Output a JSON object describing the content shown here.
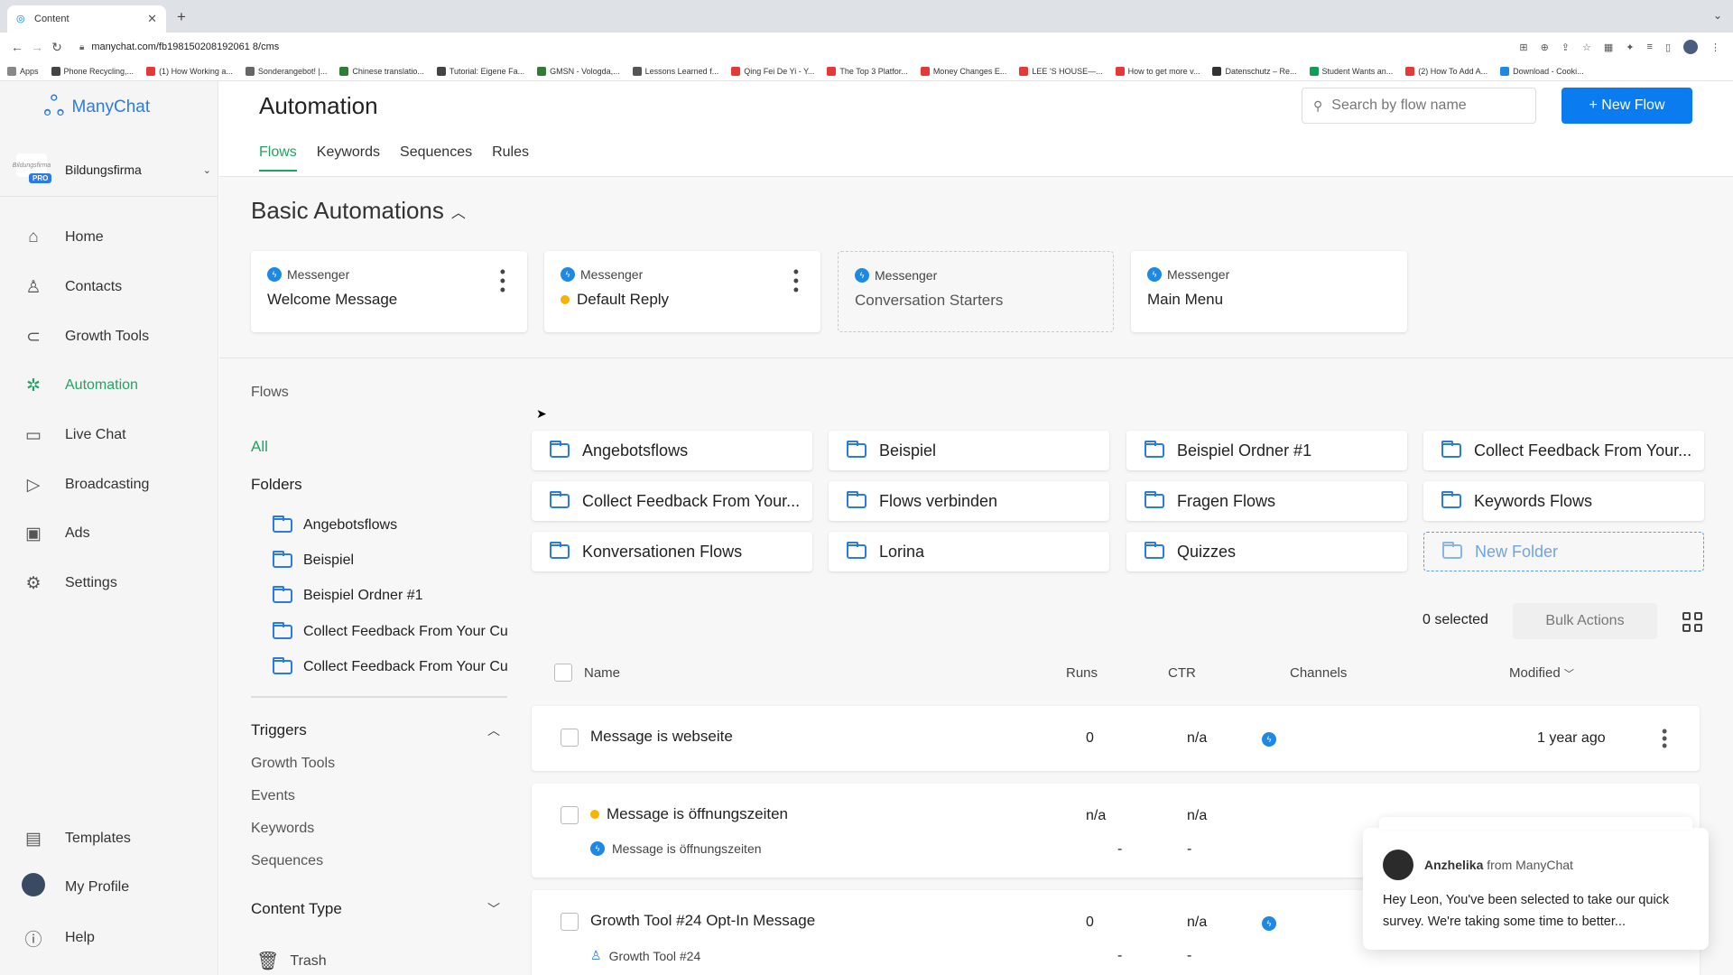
{
  "browser": {
    "tab_title": "Content",
    "url": "manychat.com/fb198150208192061 8/cms",
    "bookmarks": [
      "Apps",
      "Phone Recycling,...",
      "(1) How Working a...",
      "Sonderangebot! |...",
      "Chinese translatio...",
      "Tutorial: Eigene Fa...",
      "GMSN - Vologda,...",
      "Lessons Learned f...",
      "Qing Fei De Yi - Y...",
      "The Top 3 Platfor...",
      "Money Changes E...",
      "LEE 'S HOUSE—...",
      "How to get more v...",
      "Datenschutz – Re...",
      "Student Wants an...",
      "(2) How To Add A...",
      "Download - Cooki..."
    ],
    "bookmark_colors": [
      "#888",
      "#444",
      "#e53935",
      "#666",
      "#2e7d32",
      "#444",
      "#2e7d32",
      "#555",
      "#e53935",
      "#e53935",
      "#e53935",
      "#e53935",
      "#e53935",
      "#333",
      "#0f9d58",
      "#e53935",
      "#1e88e5"
    ]
  },
  "sidebar": {
    "logo": "ManyChat",
    "account_name": "Bildungsfirma",
    "account_badge": "PRO",
    "account_logo_text": "Bildungsfirma",
    "items": [
      {
        "label": "Home",
        "icon": "⌂"
      },
      {
        "label": "Contacts",
        "icon": "♙"
      },
      {
        "label": "Growth Tools",
        "icon": "⊂"
      },
      {
        "label": "Automation",
        "icon": "✲"
      },
      {
        "label": "Live Chat",
        "icon": "▭"
      },
      {
        "label": "Broadcasting",
        "icon": "▷"
      },
      {
        "label": "Ads",
        "icon": "▣"
      },
      {
        "label": "Settings",
        "icon": "⚙"
      }
    ],
    "bottom": {
      "templates": "Templates",
      "my_profile": "My Profile",
      "help": "Help"
    }
  },
  "header": {
    "title": "Automation",
    "search_placeholder": "Search by flow name",
    "new_flow": "+ New Flow",
    "tabs": [
      "Flows",
      "Keywords",
      "Sequences",
      "Rules"
    ]
  },
  "basic": {
    "title": "Basic Automations",
    "cards": [
      {
        "channel": "Messenger",
        "name": "Welcome Message"
      },
      {
        "channel": "Messenger",
        "name": "Default Reply"
      },
      {
        "channel": "Messenger",
        "name": "Conversation Starters"
      },
      {
        "channel": "Messenger",
        "name": "Main Menu"
      }
    ]
  },
  "flows": {
    "label": "Flows",
    "all": "All",
    "folders_heading": "Folders",
    "left_folders": [
      "Angebotsflows",
      "Beispiel",
      "Beispiel Ordner #1",
      "Collect Feedback From Your Cu",
      "Collect Feedback From Your Cu"
    ],
    "triggers_heading": "Triggers",
    "triggers": [
      "Growth Tools",
      "Events",
      "Keywords",
      "Sequences"
    ],
    "content_type_heading": "Content Type",
    "trash": "Trash",
    "grid_folders": [
      "Angebotsflows",
      "Beispiel",
      "Beispiel Ordner #1",
      "Collect Feedback From Your...",
      "Collect Feedback From Your...",
      "Flows verbinden",
      "Fragen Flows",
      "Keywords Flows",
      "Konversationen Flows",
      "Lorina",
      "Quizzes"
    ],
    "new_folder": "New Folder"
  },
  "table": {
    "selected": "0 selected",
    "bulk_actions": "Bulk Actions",
    "columns": {
      "name": "Name",
      "runs": "Runs",
      "ctr": "CTR",
      "channels": "Channels",
      "modified": "Modified"
    },
    "rows": [
      {
        "name": "Message is webseite",
        "runs": "0",
        "ctr": "n/a",
        "modified": "1 year ago"
      },
      {
        "name": "Message is öffnungszeiten",
        "runs": "n/a",
        "ctr": "n/a",
        "sub": "Message is öffnungszeiten",
        "sub_runs": "-",
        "sub_ctr": "-"
      },
      {
        "name": "Growth Tool #24 Opt-In Message",
        "runs": "0",
        "ctr": "n/a",
        "sub": "Growth Tool #24",
        "sub_runs": "-",
        "sub_ctr": "-"
      }
    ]
  },
  "chat": {
    "author": "Anzhelika",
    "from": "from ManyChat",
    "message": "Hey Leon,  You've been selected to take our quick survey. We're taking some time to better..."
  }
}
